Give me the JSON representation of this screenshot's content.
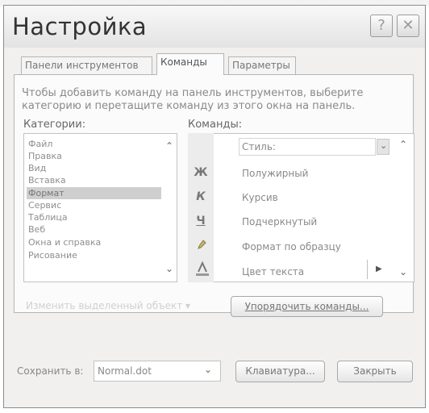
{
  "dialog": {
    "title": "Настройка",
    "help_symbol": "?",
    "close_symbol": "✕"
  },
  "tabs": [
    {
      "label": "Панели инструментов"
    },
    {
      "label": "Команды"
    },
    {
      "label": "Параметры"
    }
  ],
  "instructions": [
    "Чтобы добавить команду на панель инструментов, выберите",
    "категорию и перетащите команду из этого окна на панель."
  ],
  "categories": {
    "label": "Категории:",
    "items": [
      "Файл",
      "Правка",
      "Вид",
      "Вставка",
      "Формат",
      "Сервис",
      "Таблица",
      "Веб",
      "Окна и справка",
      "Рисование"
    ],
    "selected": "Формат"
  },
  "commands": {
    "label": "Команды:",
    "items": [
      {
        "icon": "",
        "label": "Стиль:"
      },
      {
        "icon": "Ж",
        "label": "Полужирный"
      },
      {
        "icon": "К",
        "label": "Курсив"
      },
      {
        "icon": "Ч",
        "label": "Подчеркнутый"
      },
      {
        "icon": "format-painter",
        "label": "Формат по образцу"
      },
      {
        "icon": "font-color",
        "label": "Цвет текста"
      }
    ]
  },
  "buttons": {
    "modify_selection": "Изменить выделенный объект",
    "rearrange": "Упорядочить команды...",
    "keyboard": "Клавиатура...",
    "close": "Закрыть"
  },
  "save_in": {
    "label": "Сохранить в:",
    "value": "Normal.dot"
  }
}
